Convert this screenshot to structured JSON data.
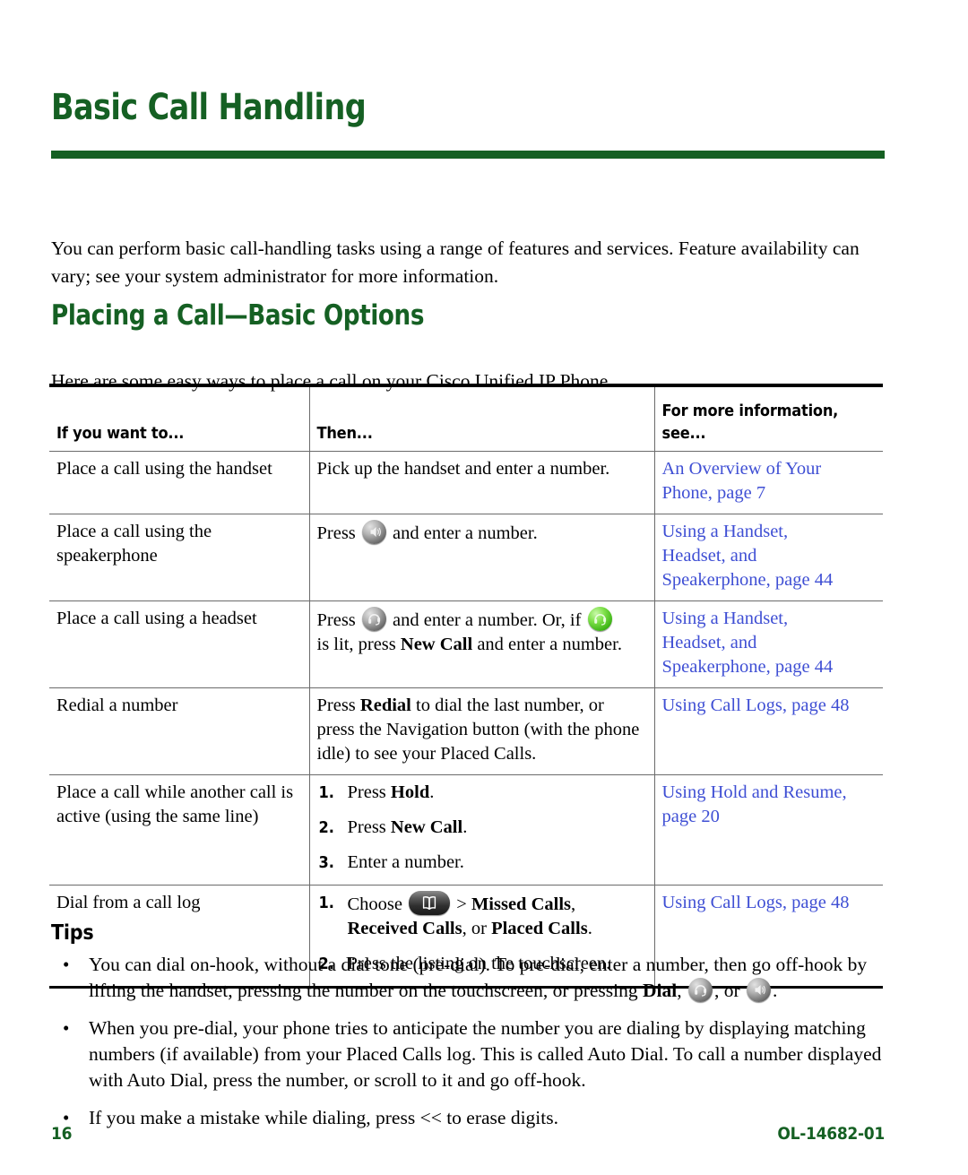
{
  "page": {
    "chapter_title": "Basic Call Handling",
    "intro_paragraph": "You can perform basic call-handling tasks using a range of features and services. Feature availability can vary; see your system administrator for more information.",
    "section_heading": "Placing a Call—Basic Options",
    "lead_paragraph": "Here are some easy ways to place a call on your Cisco Unified IP Phone.",
    "accent_green": "#156023",
    "xref_blue": "#3f4fd4"
  },
  "table": {
    "headers": {
      "col1": "If you want to...",
      "col2": "Then...",
      "col3_line1": "For more information,",
      "col3_line2": "see..."
    },
    "rows": [
      {
        "task": "Place a call using the handset",
        "action_pre": "Pick up the handset and enter a number.",
        "xref": [
          "An Overview of Your",
          "Phone, page 7"
        ]
      },
      {
        "task": "Place a call using the speakerphone",
        "action_pre": "Press",
        "action_post": "and enter a number.",
        "icon": "speakerphone-icon",
        "xref": [
          "Using a Handset,",
          "Headset, and",
          "Speakerphone, page 44"
        ]
      },
      {
        "task": "Place a call using a headset",
        "action_pre": "Press",
        "action_mid": "and enter a number. Or, if",
        "action_tail_bold": "New Call",
        "action_tail_pre": "is lit, press",
        "action_tail_post": "and enter a number.",
        "icon": "headset-icon",
        "icon_lit": "headset-lit-icon",
        "xref": [
          "Using a Handset,",
          "Headset, and",
          "Speakerphone, page 44"
        ]
      },
      {
        "task": "Redial a number",
        "action_pre": "Press",
        "action_bold": "Redial",
        "action_post": "to dial the last number, or press the Navigation button (with the phone idle) to see your Placed Calls.",
        "xref": [
          "Using Call Logs, page 48"
        ]
      },
      {
        "task": "Place a call while another call is active (using the same line)",
        "steps": [
          {
            "num": "1.",
            "pre": "Press ",
            "bold": "Hold",
            "post": "."
          },
          {
            "num": "2.",
            "pre": "Press ",
            "bold": "New Call",
            "post": "."
          },
          {
            "num": "3.",
            "pre": "Enter a number.",
            "bold": "",
            "post": ""
          }
        ],
        "xref": [
          "Using Hold and Resume,",
          "page 20"
        ]
      },
      {
        "task": "Dial from a call log",
        "steps_icon": [
          {
            "num": "1.",
            "pre": "Choose",
            "icon": "directories-icon",
            "sep": "> ",
            "bold1": "Missed Calls",
            "mid": ",",
            "bold2": "Received Calls",
            "mid2": ", or ",
            "bold3": "Placed Calls",
            "post": "."
          },
          {
            "num": "2.",
            "pre": "Press the listing on the touchscreen.",
            "bold1": "",
            "post": ""
          }
        ],
        "xref": [
          "Using Call Logs, page 48"
        ]
      }
    ]
  },
  "tips": {
    "heading": "Tips",
    "items": [
      {
        "part1": "You can dial on-hook, without a dial tone (pre-dial). To pre-dial, enter a number, then go off-hook by lifting the handset, pressing the number on the touchscreen, or pressing ",
        "bold": "Dial",
        "part2": ", ",
        "part3": ", or ",
        "part4": "."
      },
      {
        "text": "When you pre-dial, your phone tries to anticipate the number you are dialing by displaying matching numbers (if available) from your Placed Calls log. This is called Auto Dial. To call a number displayed with Auto Dial, press the number, or scroll to it and go off-hook."
      },
      {
        "text": "If you make a mistake while dialing, press << to erase digits."
      }
    ],
    "bullet_glyph": "•"
  },
  "footer": {
    "page_number": "16",
    "doc_id": "OL-14682-01"
  }
}
